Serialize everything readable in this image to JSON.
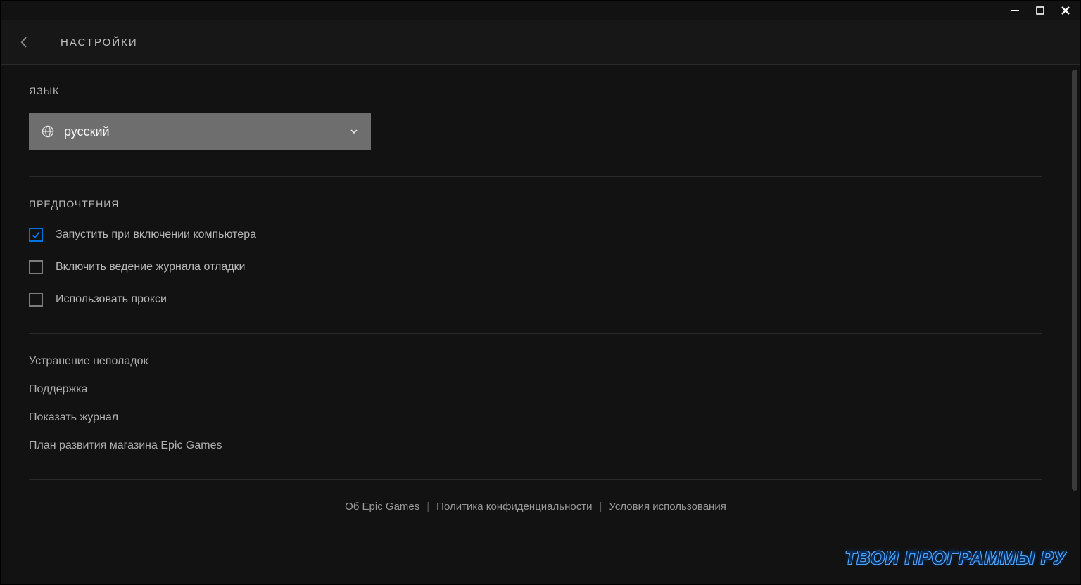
{
  "header": {
    "title": "НАСТРОЙКИ"
  },
  "sections": {
    "language": {
      "label": "ЯЗЫК",
      "selected": "русский"
    },
    "preferences": {
      "label": "ПРЕДПОЧТЕНИЯ",
      "options": [
        {
          "label": "Запустить при включении компьютера",
          "checked": true
        },
        {
          "label": "Включить ведение журнала отладки",
          "checked": false
        },
        {
          "label": "Использовать прокси",
          "checked": false
        }
      ]
    }
  },
  "links": [
    "Устранение неполадок",
    "Поддержка",
    "Показать журнал",
    "План развития магазина Epic Games"
  ],
  "footer": [
    "Об Epic Games",
    "Политика конфиденциальности",
    "Условия использования"
  ],
  "watermark": "ТВОИ ПРОГРАММЫ РУ"
}
